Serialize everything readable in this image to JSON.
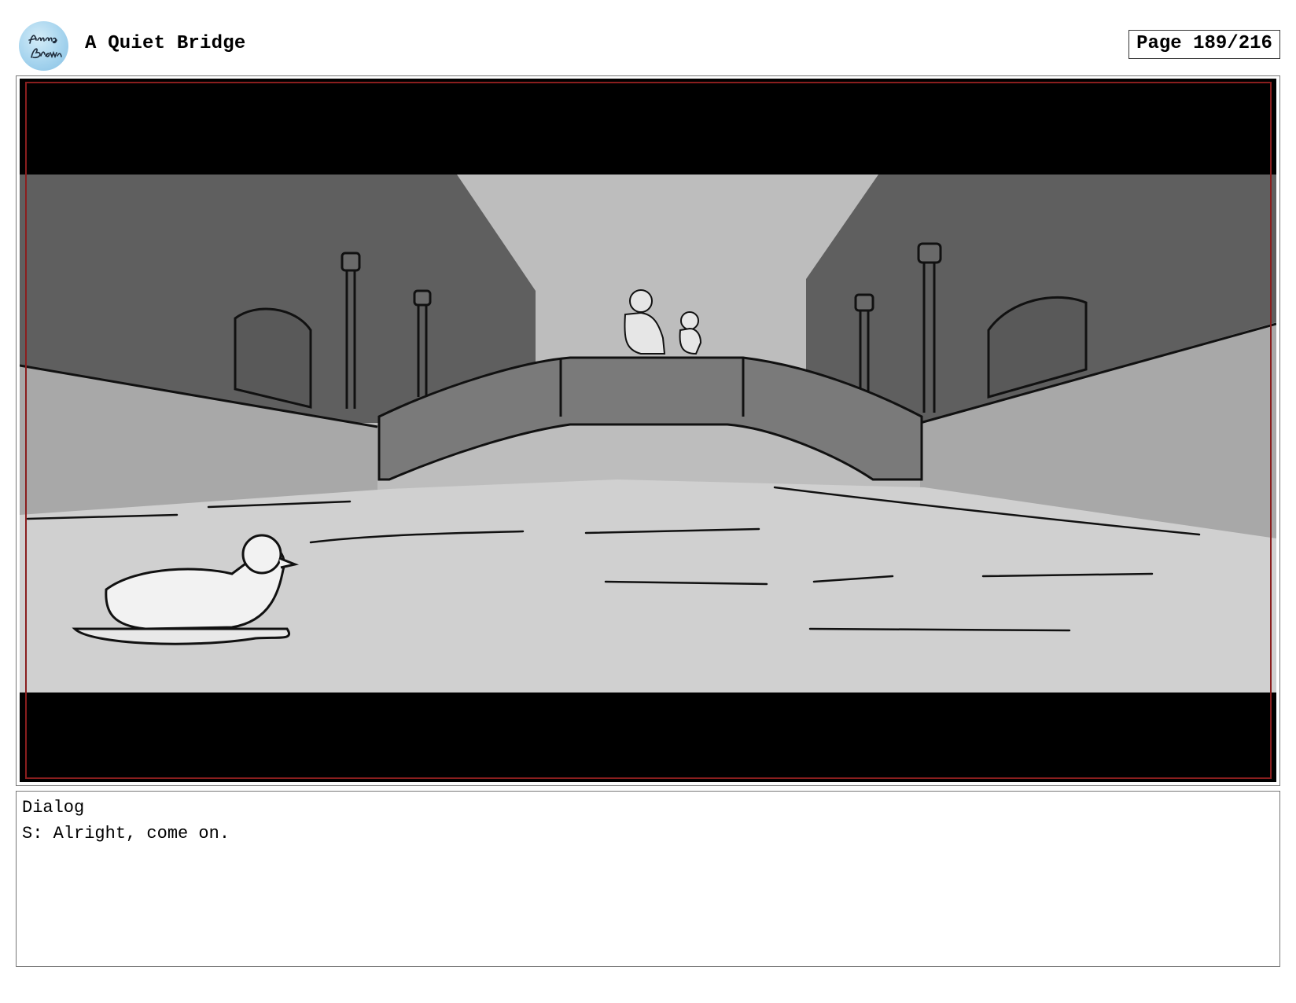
{
  "header": {
    "logo_text": "Anna Brown",
    "title": "A Quiet Bridge",
    "page": "Page 189/216"
  },
  "dialog": {
    "label": "Dialog",
    "lines": [
      "S: Alright, come on."
    ]
  },
  "colors": {
    "frame_border": "#777777",
    "safe_frame": "#8a1e1e",
    "logo_blue": "#a6d4ee"
  }
}
